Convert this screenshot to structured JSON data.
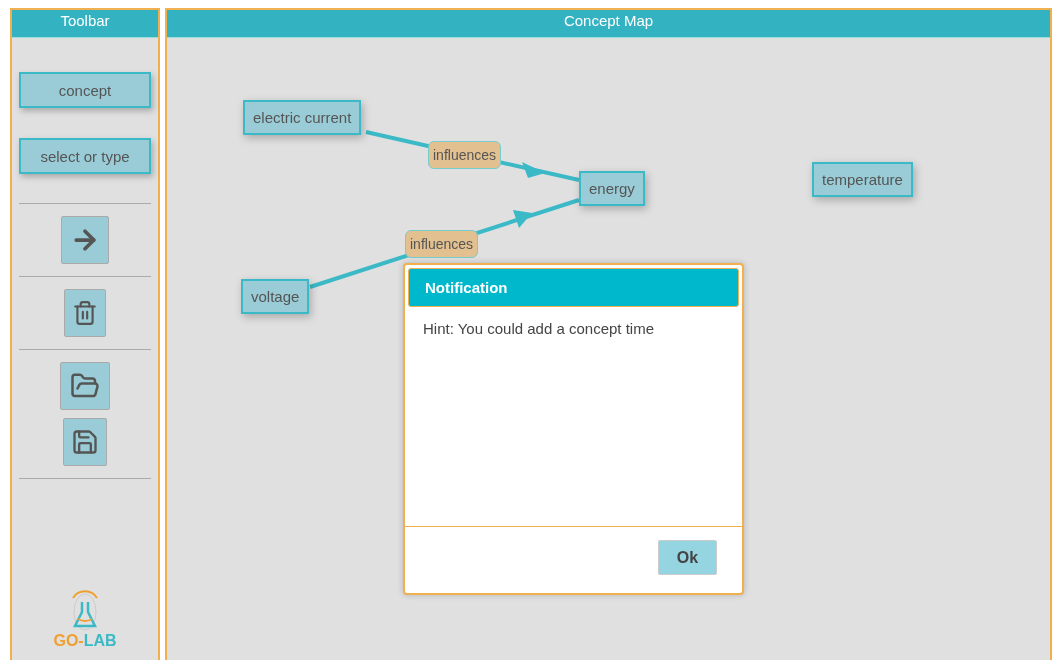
{
  "toolbar": {
    "title": "Toolbar",
    "concept_button": "concept",
    "relation_field": {
      "placeholder": "select or type"
    },
    "logo_text": [
      "GO-",
      "LAB"
    ]
  },
  "concept_map": {
    "title": "Concept Map",
    "concepts": [
      "electric current",
      "energy",
      "temperature",
      "voltage"
    ],
    "links": [
      {
        "label": "influences"
      },
      {
        "label": "influences"
      }
    ]
  },
  "notification": {
    "title": "Notification",
    "message": "Hint: You could add a concept time",
    "button": "Ok"
  }
}
